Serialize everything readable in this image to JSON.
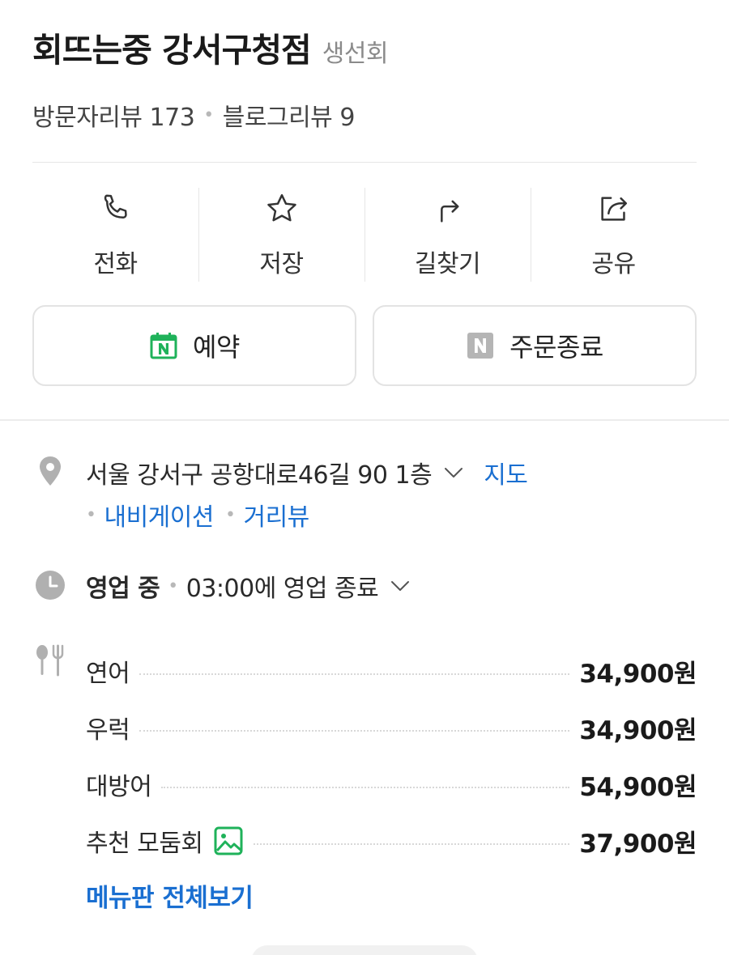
{
  "place": {
    "name": "회뜨는중 강서구청점",
    "category": "생선회",
    "visitor_reviews": "방문자리뷰 173",
    "blog_reviews": "블로그리뷰 9"
  },
  "actions": [
    {
      "label": "전화",
      "icon": "phone-icon"
    },
    {
      "label": "저장",
      "icon": "star-icon"
    },
    {
      "label": "길찾기",
      "icon": "directions-icon"
    },
    {
      "label": "공유",
      "icon": "share-icon"
    }
  ],
  "buttons": {
    "reserve": "예약",
    "order": "주문종료"
  },
  "address": {
    "text": "서울 강서구 공항대로46길 90 1층",
    "map_link": "지도",
    "navigation_link": "내비게이션",
    "streetview_link": "거리뷰"
  },
  "hours": {
    "status": "영업 중",
    "closing": "03:00에 영업 종료"
  },
  "menu": {
    "items": [
      {
        "name": "연어",
        "price": "34,900원"
      },
      {
        "name": "우럭",
        "price": "34,900원"
      },
      {
        "name": "대방어",
        "price": "54,900원"
      },
      {
        "name": "추천 모둠회",
        "price": "37,900원",
        "has_image": true
      }
    ],
    "view_all": "메뉴판 전체보기"
  },
  "colors": {
    "link": "#1a6fd1",
    "naver_green": "#1fb25a",
    "inactive_gray": "#b5b5b5"
  }
}
